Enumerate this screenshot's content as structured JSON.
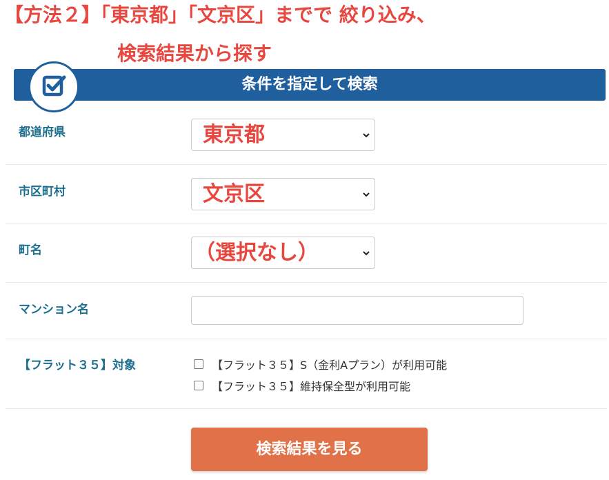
{
  "heading": {
    "line1": "【方法２】「東京都」「文京区」までで 絞り込み、",
    "line2": "検索結果から探す"
  },
  "banner": {
    "title": "条件を指定して検索",
    "icon": "checkbox-check-icon"
  },
  "form": {
    "prefecture": {
      "label": "都道府県",
      "value": "東京都"
    },
    "city": {
      "label": "市区町村",
      "value": "文京区"
    },
    "town": {
      "label": "町名",
      "value": "（選択なし）"
    },
    "mansion": {
      "label": "マンション名",
      "value": "",
      "placeholder": ""
    },
    "flat35": {
      "label": "【フラット３５】対象",
      "options": [
        {
          "label": "【フラット３５】S（金利Aプラン）が利用可能",
          "checked": false
        },
        {
          "label": "【フラット３５】維持保全型が利用可能",
          "checked": false
        }
      ]
    }
  },
  "submit": {
    "label": "検索結果を見る"
  },
  "colors": {
    "heading_red": "#e8473f",
    "banner_blue": "#1f5f9e",
    "label_teal": "#1d6f8f",
    "button_orange": "#e07148"
  }
}
